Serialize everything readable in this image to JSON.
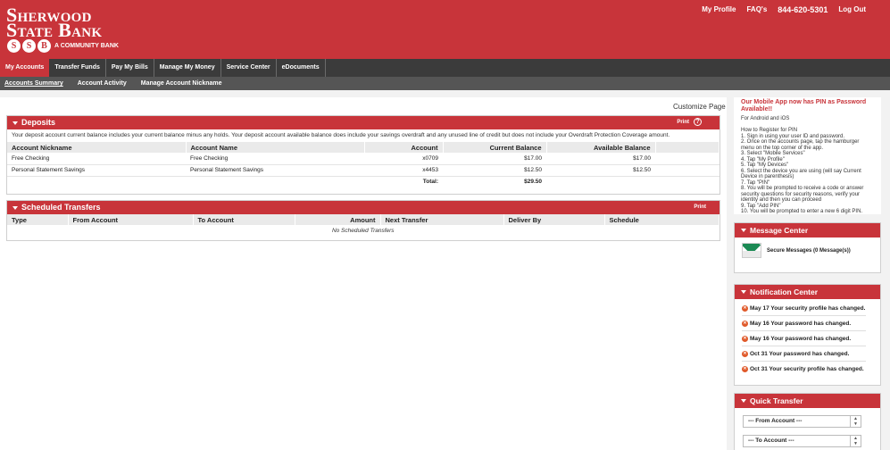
{
  "brand": {
    "line1": "Sherwood",
    "line2": "State Bank",
    "badges": [
      "S",
      "S",
      "B"
    ],
    "tagline": "A COMMUNITY BANK",
    "accent": "#c8343a"
  },
  "top_links": {
    "profile": "My Profile",
    "faq": "FAQ's",
    "phone": "844-620-5301",
    "logout": "Log Out"
  },
  "nav": {
    "tabs": [
      "My Accounts",
      "Transfer Funds",
      "Pay My Bills",
      "Manage My Money",
      "Service Center",
      "eDocuments"
    ],
    "active": "My Accounts"
  },
  "subnav": {
    "items": [
      "Accounts Summary",
      "Account Activity",
      "Manage Account Nickname"
    ],
    "active": "Accounts Summary"
  },
  "customize": "Customize Page",
  "deposits": {
    "title": "Deposits",
    "print": "Print",
    "help_icon": "question-circle-icon",
    "note": "Your deposit account current balance includes your current balance minus any holds. Your deposit account available balance does include your savings overdraft and any unused line of credit but does not include your Overdraft Protection Coverage amount.",
    "columns": [
      "Account Nickname",
      "Account Name",
      "Account",
      "Current Balance",
      "Available Balance"
    ],
    "rows": [
      [
        "Free Checking",
        "Free Checking",
        "x0709",
        "$17.00",
        "$17.00"
      ],
      [
        "Personal Statement Savings",
        "Personal Statement Savings",
        "x4453",
        "$12.50",
        "$12.50"
      ]
    ],
    "total_label": "Total:",
    "total_value": "$29.50"
  },
  "scheduled": {
    "title": "Scheduled Transfers",
    "print": "Print",
    "columns": [
      "Type",
      "From Account",
      "To Account",
      "Amount",
      "Next Transfer",
      "Deliver By",
      "Schedule"
    ],
    "empty": "No Scheduled Transfers"
  },
  "promo": {
    "title": "Our Mobile App now has PIN as Password Available!!",
    "subtitle": "For Android and iOS",
    "steps": [
      "How to Register for PIN",
      "1. Sign in using your user ID and password.",
      "2. Once on the accounts page, tap the hamburger menu on the top corner of the app.",
      "3. Select \"Mobile Services\"",
      "4. Tap \"My Profile\"",
      "5. Tap \"My Devices\"",
      "6. Select the device you are using (will say Current Device in parenthesis)",
      "7. Tap \"PIN\"",
      "8. You will be prompted to receive a code or answer security questions for security reasons, verify your identity and then you can proceed",
      "9. Tap \"Add PIN\"",
      "10. You will be prompted to enter a new 6 digit PIN."
    ]
  },
  "message_center": {
    "title": "Message Center",
    "icon": "envelope-icon",
    "text": "Secure Messages (0 Message(s))"
  },
  "notification_center": {
    "title": "Notification Center",
    "items": [
      "May 17 Your security profile has changed.",
      "May 16 Your password has changed.",
      "May 16 Your password has changed.",
      "Oct 31 Your password has changed.",
      "Oct 31 Your security profile has changed."
    ]
  },
  "quick_transfer": {
    "title": "Quick Transfer",
    "from_value": "--- From Account ---",
    "to_value": "--- To Account ---"
  }
}
